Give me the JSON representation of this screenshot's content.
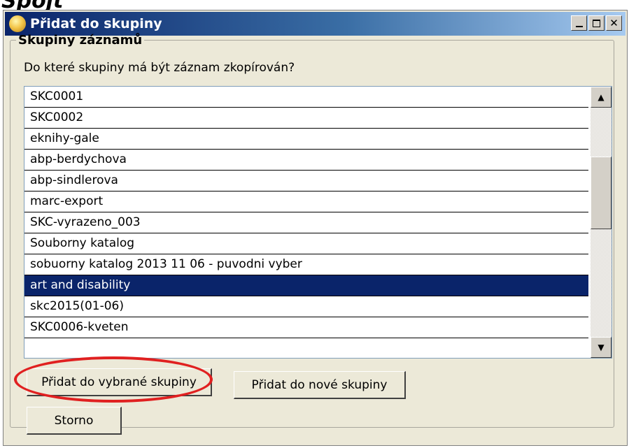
{
  "header_fragment": "Spojt",
  "window": {
    "title": "Přidat do skupiny",
    "minimize_label": "_",
    "close_label": "✕"
  },
  "group": {
    "legend": "Skupiny záznamů",
    "question": "Do které skupiny má být záznam zkopírován?"
  },
  "list": {
    "items": [
      "SKC0001",
      "SKC0002",
      "eknihy-gale",
      "abp-berdychova",
      "abp-sindlerova",
      "marc-export",
      "SKC-vyrazeno_003",
      "Souborny katalog",
      "sobuorny katalog 2013 11 06 - puvodni vyber",
      "art and disability",
      "skc2015(01-06)",
      "SKC0006-kveten"
    ],
    "selected_index": 9
  },
  "scrollbar": {
    "up_arrow": "▲",
    "down_arrow": "▼"
  },
  "buttons": {
    "add_selected": "Přidat do vybrané skupiny",
    "add_new": "Přidat do nové skupiny",
    "cancel": "Storno"
  },
  "colors": {
    "selection": "#0a246a",
    "annotation": "#e02020",
    "title_gradient_start": "#0a246a"
  },
  "icons": {
    "app": "app-globe-icon",
    "minimize": "minimize-icon",
    "maximize": "maximize-icon",
    "close": "close-icon"
  }
}
